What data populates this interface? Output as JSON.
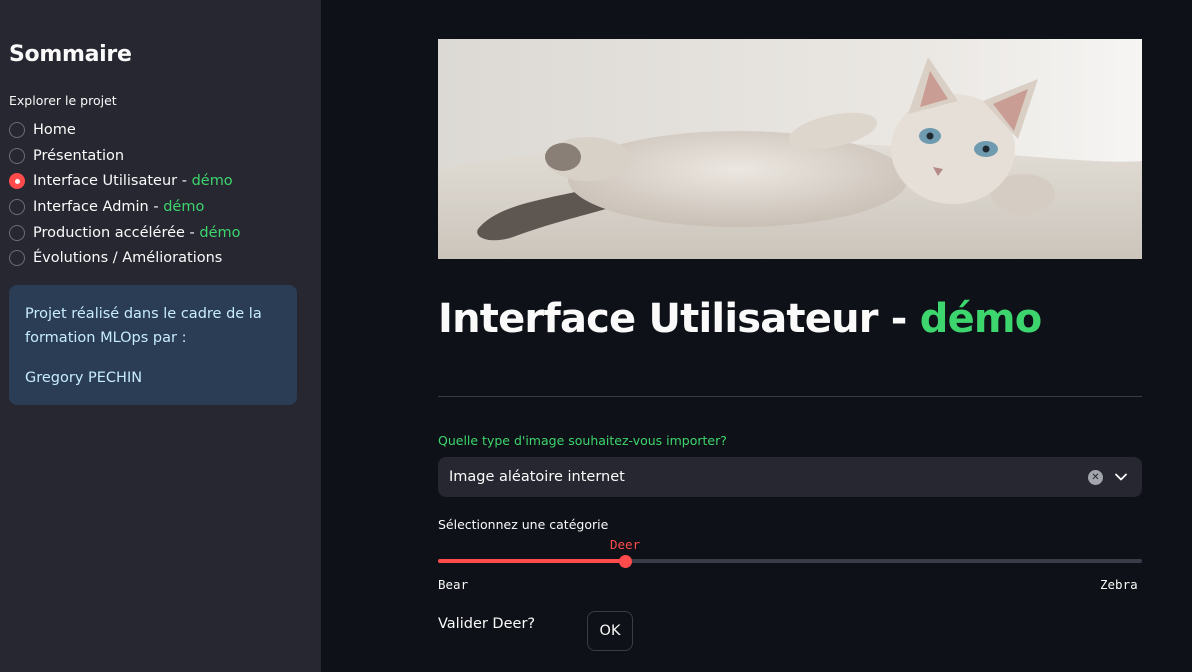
{
  "sidebar": {
    "title": "Sommaire",
    "nav_label": "Explorer le projet",
    "items": [
      {
        "label": "Home",
        "suffix": "",
        "selected": false
      },
      {
        "label": "Présentation",
        "suffix": "",
        "selected": false
      },
      {
        "label": "Interface Utilisateur - ",
        "suffix": "démo",
        "selected": true
      },
      {
        "label": "Interface Admin - ",
        "suffix": "démo",
        "selected": false
      },
      {
        "label": "Production accélérée - ",
        "suffix": "démo",
        "selected": false
      },
      {
        "label": "Évolutions / Améliorations",
        "suffix": "",
        "selected": false
      }
    ],
    "info": {
      "text": "Projet réalisé dans le cadre de la formation MLOps par :",
      "author": "Gregory PECHIN"
    }
  },
  "main": {
    "hero_image": "kitten-photo",
    "title": "Interface Utilisateur - ",
    "title_accent": "démo",
    "select": {
      "label": "Quelle type d'image souhaitez-vous importer?",
      "value": "Image aléatoire internet"
    },
    "slider": {
      "label": "Sélectionnez une catégorie",
      "value": "Deer",
      "min": "Bear",
      "max": "Zebra",
      "position_fraction": 0.267
    },
    "validate": {
      "label": "Valider Deer?",
      "button": "OK"
    }
  },
  "colors": {
    "background": "#0e1117",
    "sidebar": "#262730",
    "accent_red": "#ff4b4b",
    "accent_green": "#3dd56d",
    "info_bg": "#2b3d55",
    "info_text": "#c7ebff"
  }
}
